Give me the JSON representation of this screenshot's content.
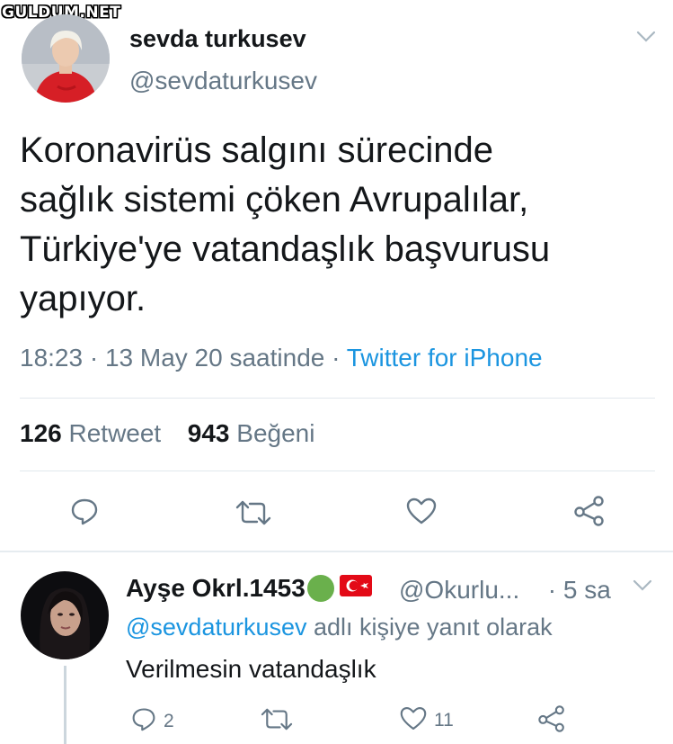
{
  "watermark": "GULDUM.NET",
  "tweet": {
    "author_name": "sevda turkusev",
    "author_handle": "@sevdaturkusev",
    "text_lines": [
      "Koronavirüs salgını sürecinde",
      "sağlık sistemi çöken Avrupalılar,",
      "Türkiye'ye vatandaşlık başvurusu",
      "yapıyor."
    ],
    "time_date": "18:23 · 13 May 20 saatinde · ",
    "source": "Twitter for iPhone",
    "retweet_count": "126",
    "retweet_label": " Retweet",
    "like_count": "943",
    "like_label": " Beğeni"
  },
  "reply": {
    "author_name": "Ayşe Okrl.1453",
    "author_handle": "@Okurlu...",
    "time": "· 5 sa",
    "replying_to_handle": "@sevdaturkusev",
    "replying_to_suffix": " adlı kişiye yanıt olarak",
    "text": "Verilmesin vatandaşlık",
    "reply_count": "2",
    "like_count": "11"
  },
  "icons": {
    "reply": "comment-icon",
    "retweet": "retweet-icon",
    "like": "heart-icon",
    "share": "share-icon",
    "more": "chevron-down-icon",
    "green_circle": "green-circle-emoji",
    "flag": "turkey-flag-emoji"
  },
  "colors": {
    "link": "#1b95e0",
    "secondary_text": "#657786",
    "divider": "#e1e8ed",
    "icon": "#657786"
  }
}
